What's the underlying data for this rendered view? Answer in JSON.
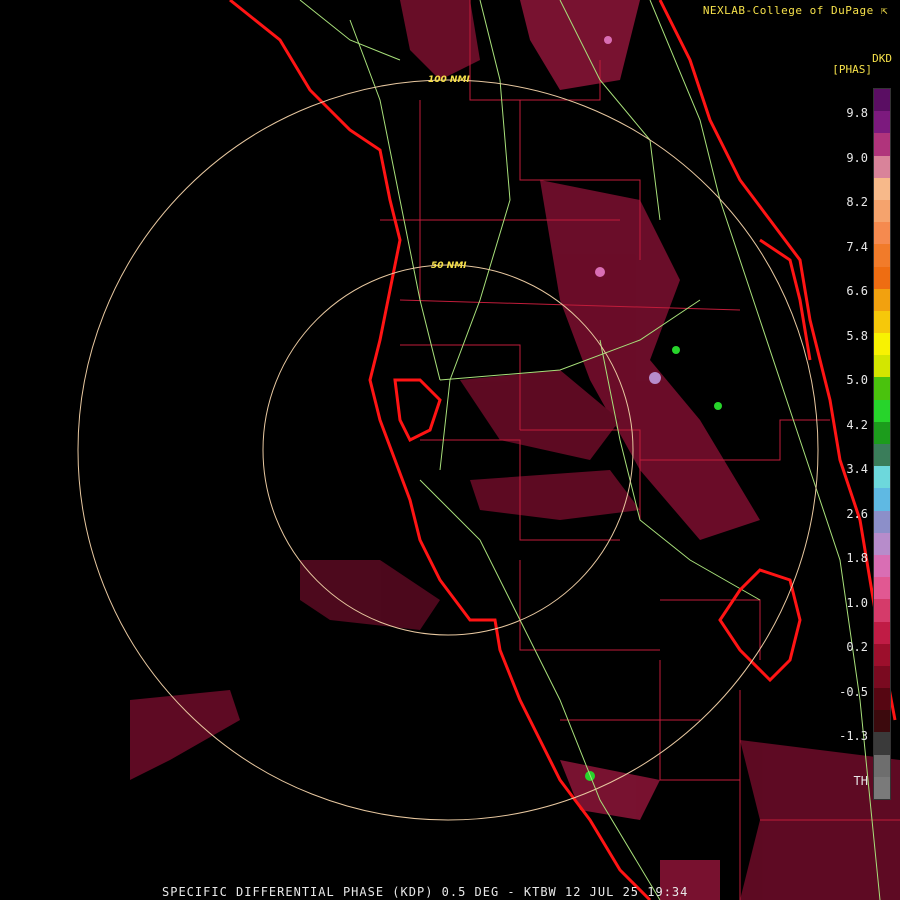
{
  "credit": "NEXLAB-College of DuPage ⇱",
  "units": {
    "code": "DKD",
    "name": "[PHAS]"
  },
  "range_rings": [
    {
      "label": "100 NMI"
    },
    {
      "label": "50 NMI"
    }
  ],
  "footer": "SPECIFIC DIFFERENTIAL PHASE (KDP) 0.5 DEG - KTBW 12 JUL 25 19:34",
  "scale": {
    "ticks": [
      "9.8",
      "9.0",
      "8.2",
      "7.4",
      "6.6",
      "5.8",
      "5.0",
      "4.2",
      "3.4",
      "2.6",
      "1.8",
      "1.0",
      "0.2",
      "-0.5",
      "-1.3",
      "TH"
    ],
    "colors": [
      "#5a0e63",
      "#7c1a7e",
      "#b0347c",
      "#d9839a",
      "#f7b98a",
      "#f5a36d",
      "#f58a4f",
      "#f17b2a",
      "#ee6d12",
      "#f2a10f",
      "#f6c80a",
      "#f8f202",
      "#d3e600",
      "#4ac20d",
      "#27d42b",
      "#1c9c1c",
      "#3a7d5a",
      "#6dd8dc",
      "#5fb9e3",
      "#8c8fc9",
      "#b78ccb",
      "#d96eb4",
      "#e15892",
      "#d53b6a",
      "#c01c45",
      "#9c0f2c",
      "#7a0a20",
      "#560612",
      "#3c0a0d",
      "#3a3a3a",
      "#6e6e6e",
      "#7a7a7a"
    ]
  },
  "colors": {
    "coast": "#ff1414",
    "county": "#c01c3a",
    "highway": "#a8e07a",
    "ring": "#e8c8a0",
    "label": "#f5e04a"
  }
}
